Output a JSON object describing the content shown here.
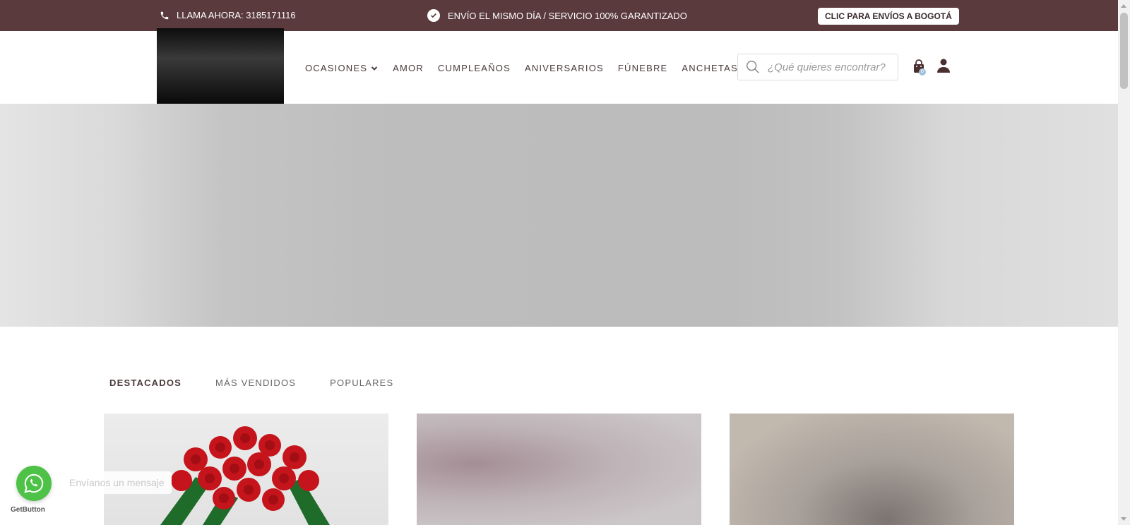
{
  "topbar": {
    "phone_text": "LLAMA AHORA: 3185171116",
    "promo_text": "ENVÍO EL MISMO DÍA / SERVICIO 100% GARANTIZADO",
    "bogota_button": "CLIC PARA ENVÍOS A BOGOTÁ",
    "background_color": "#5a3a3c"
  },
  "nav": {
    "items": [
      "OCASIONES",
      "AMOR",
      "CUMPLEAÑOS",
      "ANIVERSARIOS",
      "FÚNEBRE",
      "ANCHETAS"
    ]
  },
  "search": {
    "placeholder": "¿Qué quieres encontrar?"
  },
  "cart": {
    "count": "0"
  },
  "tabs": [
    "DESTACADOS",
    "MÁS VENDIDOS",
    "POPULARES"
  ],
  "whatsapp": {
    "message": "Envíanos un mensaje",
    "brand": "GetButton",
    "color": "#4dc247"
  },
  "icons": [
    "phone-icon",
    "check-icon",
    "chevron-down-icon",
    "search-icon",
    "shopping-bag-icon",
    "user-icon",
    "whatsapp-icon"
  ]
}
